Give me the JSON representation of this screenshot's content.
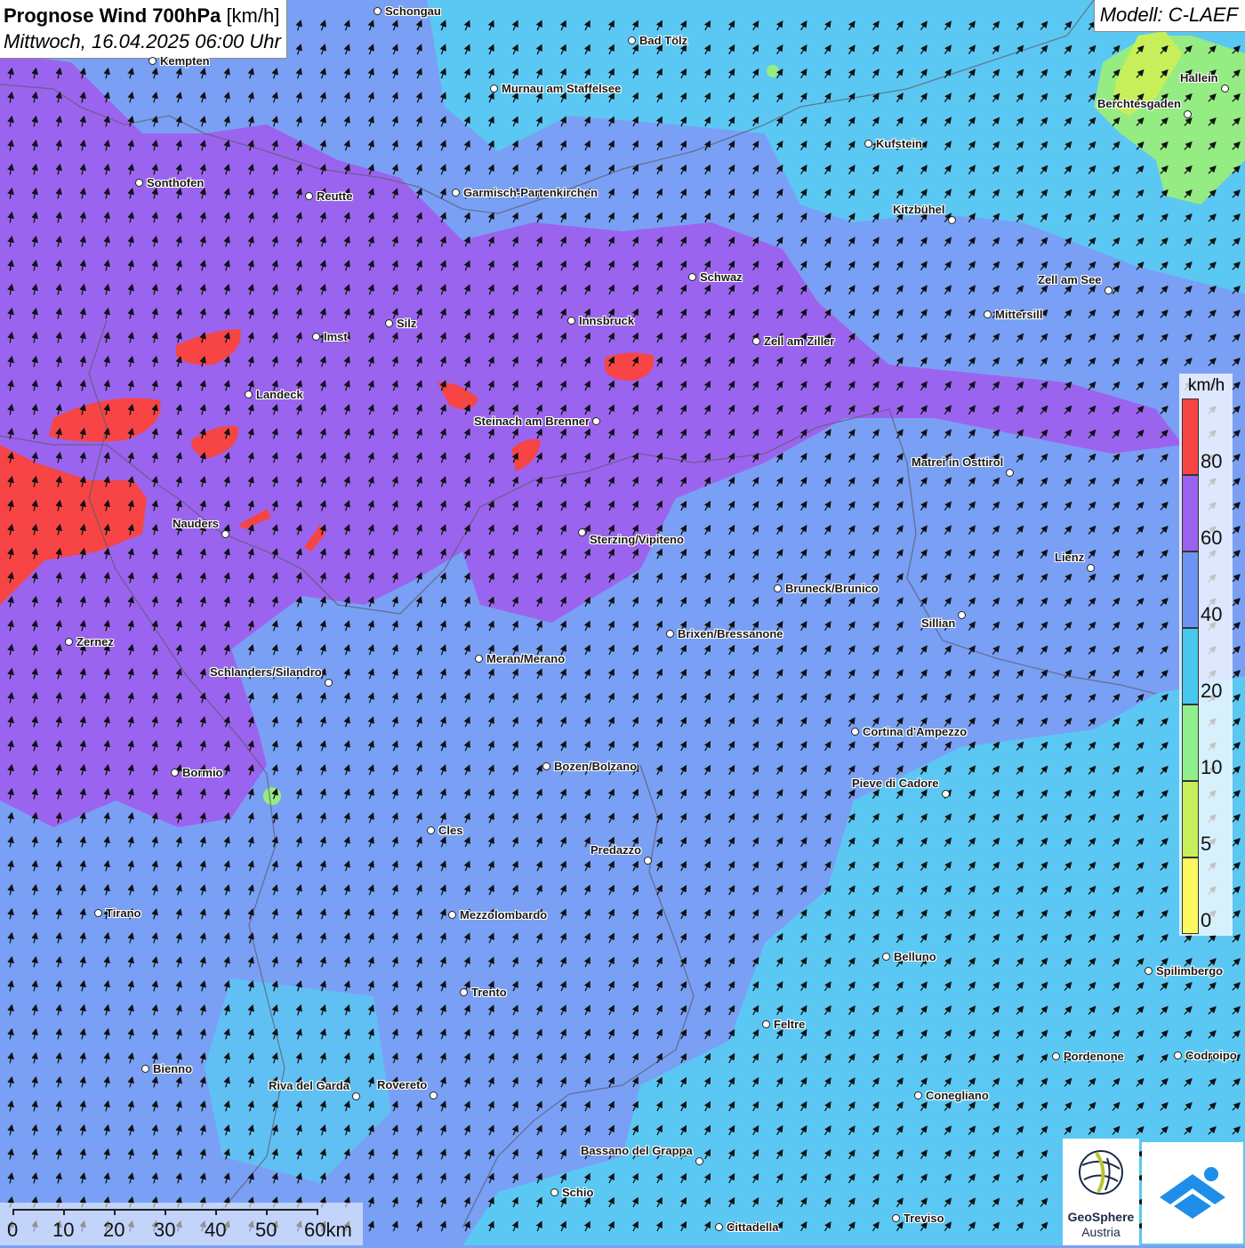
{
  "header": {
    "title_bold": "Prognose Wind 700hPa",
    "title_unit": "[km/h]",
    "subtitle": "Mittwoch, 16.04.2025 06:00 Uhr",
    "model": "Modell: C-LAEF"
  },
  "legend": {
    "unit": "km/h",
    "classes": [
      {
        "label": "0",
        "color": "#fbf862"
      },
      {
        "label": "5",
        "color": "#c7ef5a"
      },
      {
        "label": "10",
        "color": "#8ff08b"
      },
      {
        "label": "20",
        "color": "#49c8ef"
      },
      {
        "label": "40",
        "color": "#6e93f2"
      },
      {
        "label": "60",
        "color": "#9a62ee"
      },
      {
        "label": "80",
        "color": "#f74444"
      }
    ]
  },
  "scale_bar": {
    "labels": [
      "0",
      "10",
      "20",
      "30",
      "40",
      "50",
      "60km"
    ]
  },
  "cities": [
    {
      "name": "Schongau"
    },
    {
      "name": "Bad Tölz"
    },
    {
      "name": "Kempten"
    },
    {
      "name": "Murnau am Staffelsee"
    },
    {
      "name": "Hallein"
    },
    {
      "name": "Berchtesgaden"
    },
    {
      "name": "Kufstein"
    },
    {
      "name": "Sonthofen"
    },
    {
      "name": "Reutte"
    },
    {
      "name": "Garmisch-Partenkirchen"
    },
    {
      "name": "Kitzbühel"
    },
    {
      "name": "Schwaz"
    },
    {
      "name": "Zell am See"
    },
    {
      "name": "Mittersill"
    },
    {
      "name": "Innsbruck"
    },
    {
      "name": "Imst"
    },
    {
      "name": "Silz"
    },
    {
      "name": "Zell am Ziller"
    },
    {
      "name": "Landeck"
    },
    {
      "name": "Steinach am Brenner"
    },
    {
      "name": "Matrei in Osttirol"
    },
    {
      "name": "Nauders"
    },
    {
      "name": "Sterzing/Vipiteno"
    },
    {
      "name": "Lienz"
    },
    {
      "name": "Bruneck/Brunico"
    },
    {
      "name": "Sillian"
    },
    {
      "name": "Zernez"
    },
    {
      "name": "Brixen/Bressanone"
    },
    {
      "name": "Meran/Merano"
    },
    {
      "name": "Schlanders/Silandro"
    },
    {
      "name": "Cortina d'Ampezzo"
    },
    {
      "name": "Bozen/Bolzano"
    },
    {
      "name": "Bormio"
    },
    {
      "name": "Pieve di Cadore"
    },
    {
      "name": "Cles"
    },
    {
      "name": "Predazzo"
    },
    {
      "name": "Tirano"
    },
    {
      "name": "Mezzolombardo"
    },
    {
      "name": "Belluno"
    },
    {
      "name": "Spilimbergo"
    },
    {
      "name": "Trento"
    },
    {
      "name": "Feltre"
    },
    {
      "name": "Pordenone"
    },
    {
      "name": "Codroipo"
    },
    {
      "name": "Bienno"
    },
    {
      "name": "Riva del Garda"
    },
    {
      "name": "Rovereto"
    },
    {
      "name": "Conegliano"
    },
    {
      "name": "Bassano del Grappa"
    },
    {
      "name": "Schio"
    },
    {
      "name": "Treviso"
    },
    {
      "name": "Cittadella"
    }
  ],
  "logos": {
    "geosphere_line1": "GeoSphere",
    "geosphere_line2": "Austria"
  }
}
